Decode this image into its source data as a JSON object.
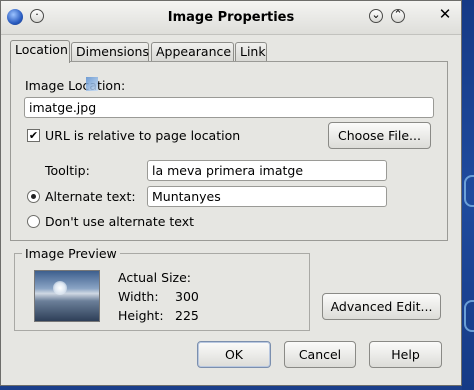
{
  "window": {
    "title": "Image Properties"
  },
  "tabs": [
    "Location",
    "Dimensions",
    "Appearance",
    "Link"
  ],
  "location": {
    "image_location_label": "Image Location:",
    "image_location_value": "imatge.jpg",
    "relative_checkbox_label": "URL is relative to page location",
    "relative_checked": true,
    "choose_file_label": "Choose File...",
    "tooltip_label": "Tooltip:",
    "tooltip_value": "la meva primera imatge",
    "alt_text_label": "Alternate text:",
    "alt_text_value": "Muntanyes",
    "no_alt_label": "Don't use alternate text",
    "alt_selected": "alternate_text"
  },
  "preview": {
    "group_title": "Image Preview",
    "actual_size_label": "Actual Size:",
    "width_label": "Width:",
    "width_value": "300",
    "height_label": "Height:",
    "height_value": "225"
  },
  "buttons": {
    "advanced_edit": "Advanced Edit...",
    "ok": "OK",
    "cancel": "Cancel",
    "help": "Help"
  }
}
